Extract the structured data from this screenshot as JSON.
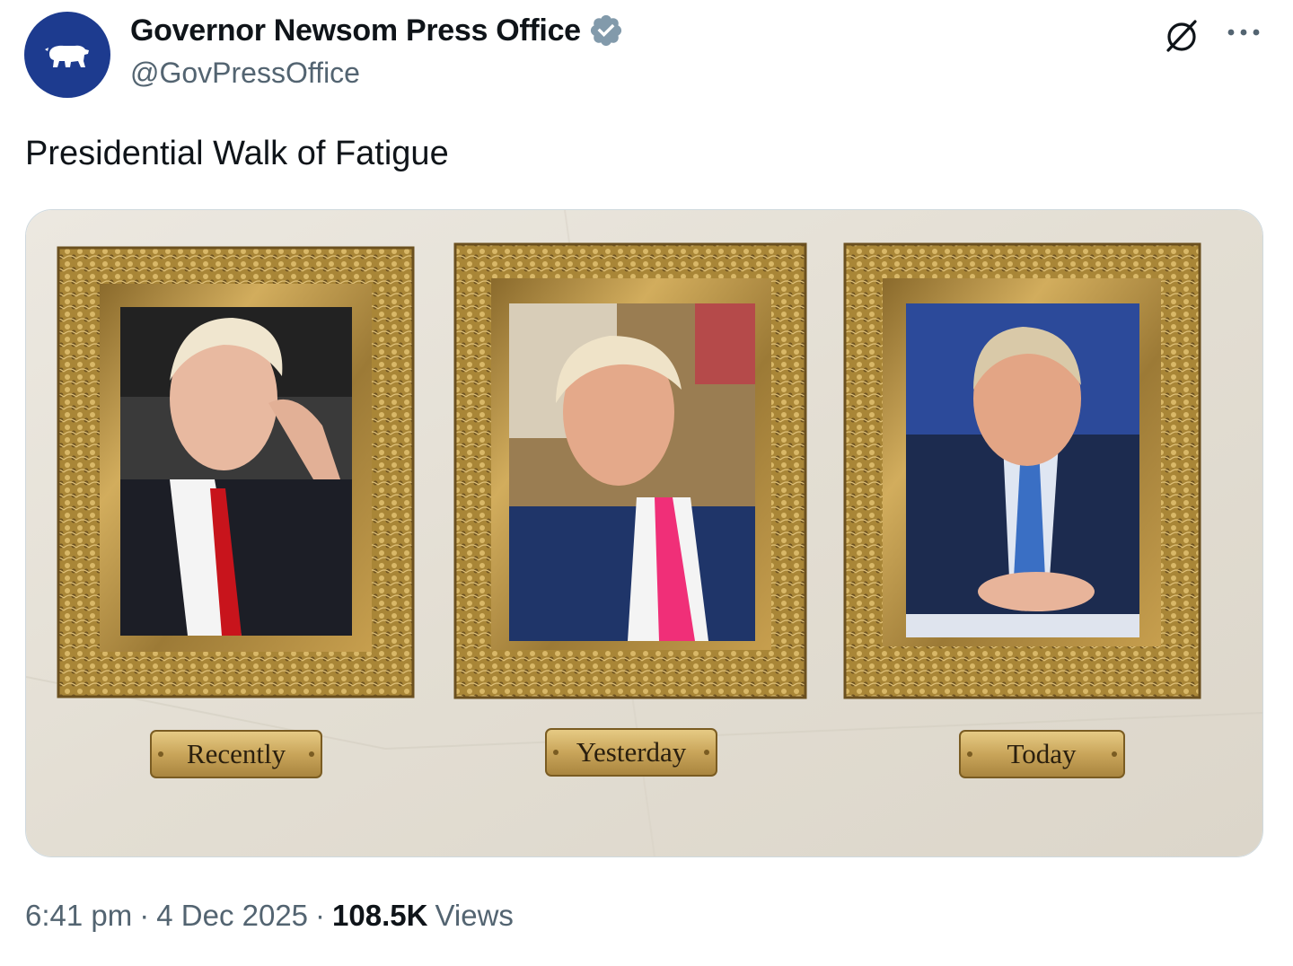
{
  "tweet": {
    "author": {
      "name": "Governor Newsom Press Office",
      "handle": "@GovPressOffice",
      "verified": true,
      "avatar_color": "#1d3b8f"
    },
    "text": "Presidential Walk of Fatigue",
    "media": {
      "background": "#e6e1d8",
      "frame_color": "#b8923f",
      "portraits": [
        {
          "plaque": "Recently",
          "suit": "#1c1e26",
          "tie": "#c8141c",
          "backdrop": "#3a3a3a"
        },
        {
          "plaque": "Yesterday",
          "suit": "#1f3569",
          "tie": "#f02f78",
          "backdrop": "#9a7d52"
        },
        {
          "plaque": "Today",
          "suit": "#1c2b4f",
          "tie": "#3a6fc4",
          "backdrop": "#2c4a9a"
        }
      ]
    },
    "time": "6:41 pm",
    "date": "4 Dec 2025",
    "separator": "·",
    "views_count": "108.5K",
    "views_label": "Views",
    "icons": {
      "avatar": "bear-icon",
      "verified": "verified-badge-icon",
      "grok": "grok-icon",
      "more": "more-icon"
    }
  }
}
